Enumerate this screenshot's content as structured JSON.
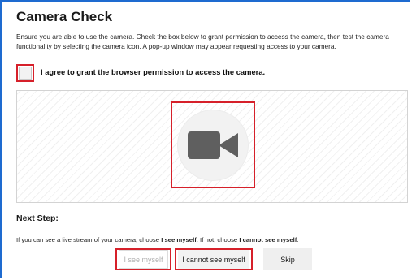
{
  "page": {
    "title": "Camera Check",
    "intro": "Ensure you are able to use the camera. Check the box below to grant permission to access the camera, then test the camera functionality by selecting the camera icon. A pop-up window may appear requesting access to your camera."
  },
  "permission": {
    "label": "I agree to grant the browser permission to access the camera.",
    "checked": false
  },
  "preview": {
    "icon": "video-camera-icon"
  },
  "next_step": {
    "title": "Next Step:",
    "instruction_prefix": "If you can see a live stream of your camera, choose ",
    "instruction_bold_1": "I see myself",
    "instruction_middle": ". If not, choose ",
    "instruction_bold_2": "I cannot see myself",
    "instruction_suffix": "."
  },
  "buttons": {
    "see_myself": "I see myself",
    "cannot_see_myself": "I cannot see myself",
    "skip": "Skip"
  },
  "colors": {
    "frame_border": "#1e6bd0",
    "highlight": "#d6202a",
    "icon": "#5f5f5f"
  }
}
